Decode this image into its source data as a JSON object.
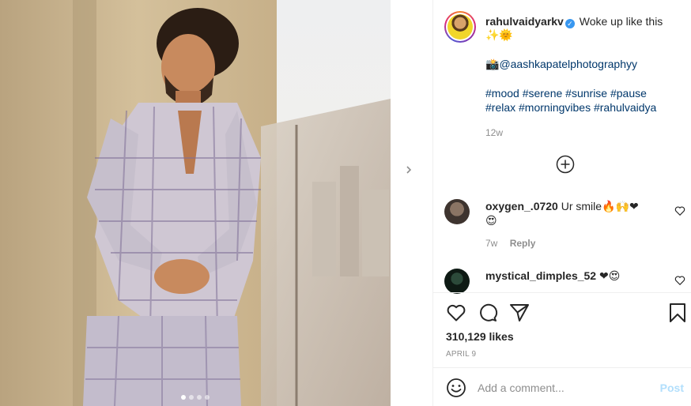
{
  "post": {
    "author": "rahulvaidyarkv",
    "verified": true,
    "caption_text": "Woke up like this",
    "caption_emoji": "✨🌞",
    "camera_emoji": "📸",
    "photographer_handle": "@aashkapatelphotographyy",
    "hashtags_line1": "#mood #serene #sunrise #pause",
    "hashtags_line2": "#relax #morningvibes #rahulvaidya",
    "age": "12w"
  },
  "photo": {
    "carousel": {
      "total": 4,
      "current": 1
    }
  },
  "comments": [
    {
      "username": "oxygen_.0720",
      "text": "Ur smile",
      "emoji": "🔥🙌❤",
      "emoji_line2": "😍",
      "age": "7w",
      "reply_label": "Reply"
    },
    {
      "username": "mystical_dimples_52",
      "text": "",
      "emoji": "❤😍"
    }
  ],
  "engagement": {
    "likes": "310,129 likes",
    "date": "APRIL 9"
  },
  "composer": {
    "placeholder": "Add a comment...",
    "post_label": "Post"
  },
  "icons": {
    "like": "heart-icon",
    "comment": "comment-bubble-icon",
    "share": "paper-plane-icon",
    "save": "bookmark-icon",
    "emoji": "smiley-icon",
    "load_more": "plus-circle-icon",
    "next": "chevron-right-icon",
    "verified": "verified-badge-icon"
  },
  "colors": {
    "text": "#262626",
    "secondary": "#8e8e8e",
    "link": "#00376b",
    "verified": "#3897f0",
    "post_disabled": "#b2dffc"
  }
}
